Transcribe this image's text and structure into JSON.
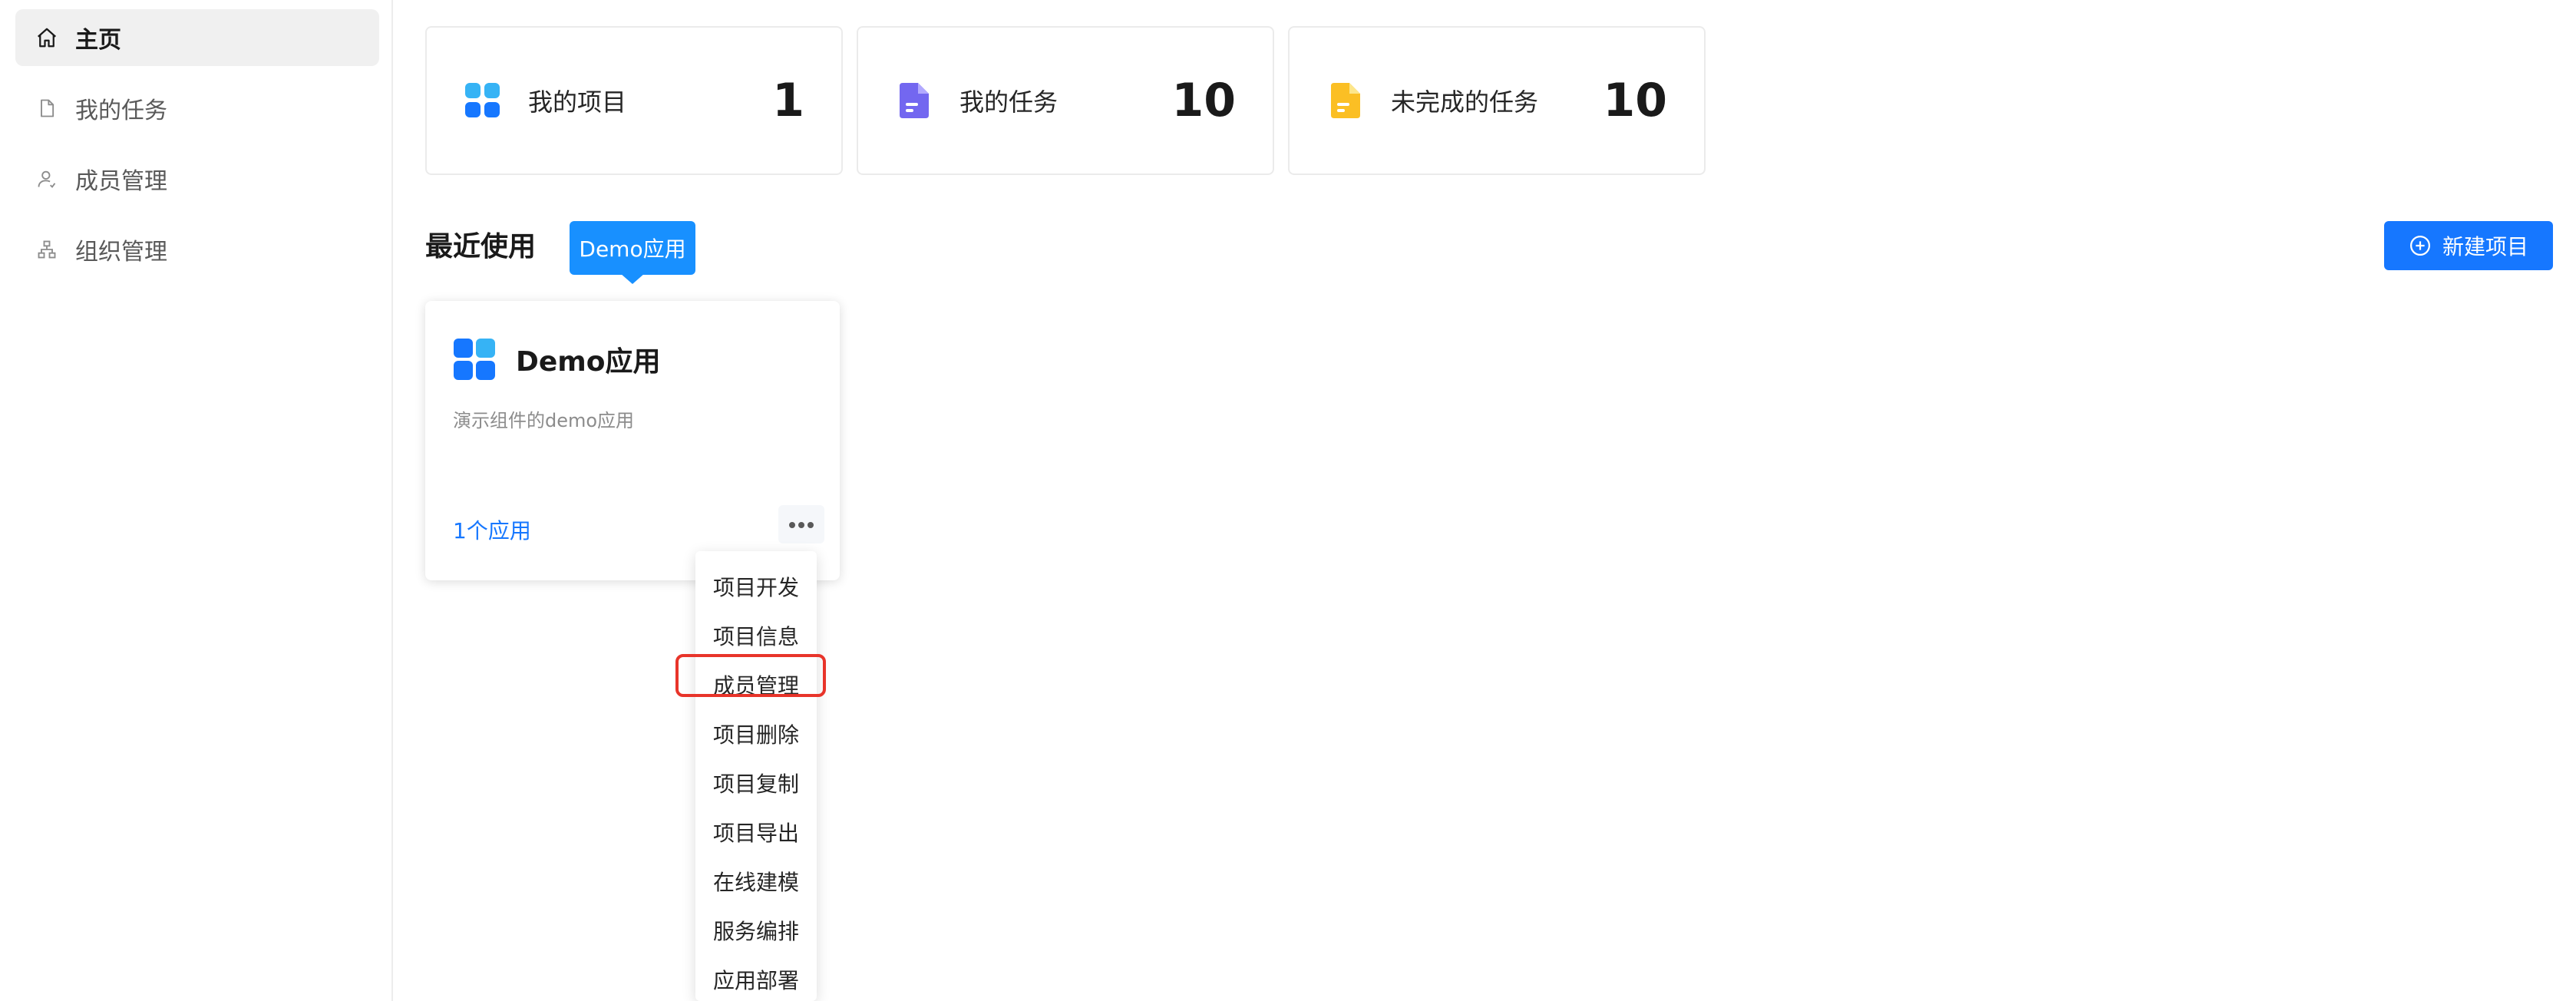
{
  "sidebar": {
    "items": [
      {
        "label": "主页",
        "icon": "home-icon",
        "active": true
      },
      {
        "label": "我的任务",
        "icon": "document-icon",
        "active": false
      },
      {
        "label": "成员管理",
        "icon": "user-icon",
        "active": false
      },
      {
        "label": "组织管理",
        "icon": "org-chart-icon",
        "active": false
      }
    ]
  },
  "stats": [
    {
      "label": "我的项目",
      "value": "1",
      "icon": "project-grid-icon",
      "color": "#1677ff"
    },
    {
      "label": "我的任务",
      "value": "10",
      "icon": "task-file-icon",
      "color": "#7367f0"
    },
    {
      "label": "未完成的任务",
      "value": "10",
      "icon": "pending-file-icon",
      "color": "#fbbf24"
    }
  ],
  "recent": {
    "title": "最近使用",
    "tooltip": "Demo应用",
    "new_button_label": "新建项目"
  },
  "project_card": {
    "name": "Demo应用",
    "description": "演示组件的demo应用",
    "app_count": "1个应用"
  },
  "dropdown_menu": {
    "items": [
      "项目开发",
      "项目信息",
      "成员管理",
      "项目删除",
      "项目复制",
      "项目导出",
      "在线建模",
      "服务编排",
      "应用部署"
    ],
    "highlighted": "成员管理",
    "highlight_color": "#e8342a"
  },
  "colors": {
    "accent": "#1677ff",
    "tooltip": "#1890ff"
  }
}
